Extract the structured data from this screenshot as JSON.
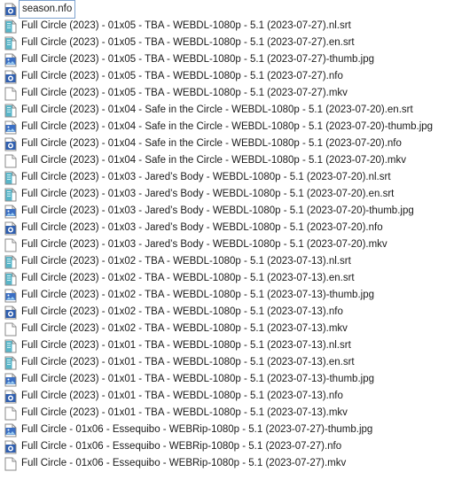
{
  "files": [
    {
      "name": "season.nfo",
      "icon": "nfo-file-icon",
      "selected": true
    },
    {
      "name": "Full Circle (2023) - 01x05 - TBA - WEBDL-1080p - 5.1 (2023-07-27).nl.srt",
      "icon": "srt-file-icon"
    },
    {
      "name": "Full Circle (2023) - 01x05 - TBA - WEBDL-1080p - 5.1 (2023-07-27).en.srt",
      "icon": "srt-file-icon"
    },
    {
      "name": "Full Circle (2023) - 01x05 - TBA - WEBDL-1080p - 5.1 (2023-07-27)-thumb.jpg",
      "icon": "jpg-file-icon"
    },
    {
      "name": "Full Circle (2023) - 01x05 - TBA - WEBDL-1080p - 5.1 (2023-07-27).nfo",
      "icon": "nfo-file-icon"
    },
    {
      "name": "Full Circle (2023) - 01x05 - TBA - WEBDL-1080p - 5.1 (2023-07-27).mkv",
      "icon": "mkv-file-icon"
    },
    {
      "name": "Full Circle (2023) - 01x04 - Safe in the Circle - WEBDL-1080p - 5.1 (2023-07-20).en.srt",
      "icon": "srt-file-icon"
    },
    {
      "name": "Full Circle (2023) - 01x04 - Safe in the Circle - WEBDL-1080p - 5.1 (2023-07-20)-thumb.jpg",
      "icon": "jpg-file-icon"
    },
    {
      "name": "Full Circle (2023) - 01x04 - Safe in the Circle - WEBDL-1080p - 5.1 (2023-07-20).nfo",
      "icon": "nfo-file-icon"
    },
    {
      "name": "Full Circle (2023) - 01x04 - Safe in the Circle - WEBDL-1080p - 5.1 (2023-07-20).mkv",
      "icon": "mkv-file-icon"
    },
    {
      "name": "Full Circle (2023) - 01x03 - Jared’s Body - WEBDL-1080p - 5.1 (2023-07-20).nl.srt",
      "icon": "srt-file-icon"
    },
    {
      "name": "Full Circle (2023) - 01x03 - Jared’s Body - WEBDL-1080p - 5.1 (2023-07-20).en.srt",
      "icon": "srt-file-icon"
    },
    {
      "name": "Full Circle (2023) - 01x03 - Jared’s Body - WEBDL-1080p - 5.1 (2023-07-20)-thumb.jpg",
      "icon": "jpg-file-icon"
    },
    {
      "name": "Full Circle (2023) - 01x03 - Jared’s Body - WEBDL-1080p - 5.1 (2023-07-20).nfo",
      "icon": "nfo-file-icon"
    },
    {
      "name": "Full Circle (2023) - 01x03 - Jared’s Body - WEBDL-1080p - 5.1 (2023-07-20).mkv",
      "icon": "mkv-file-icon"
    },
    {
      "name": "Full Circle (2023) - 01x02 - TBA - WEBDL-1080p - 5.1 (2023-07-13).nl.srt",
      "icon": "srt-file-icon"
    },
    {
      "name": "Full Circle (2023) - 01x02 - TBA - WEBDL-1080p - 5.1 (2023-07-13).en.srt",
      "icon": "srt-file-icon"
    },
    {
      "name": "Full Circle (2023) - 01x02 - TBA - WEBDL-1080p - 5.1 (2023-07-13)-thumb.jpg",
      "icon": "jpg-file-icon"
    },
    {
      "name": "Full Circle (2023) - 01x02 - TBA - WEBDL-1080p - 5.1 (2023-07-13).nfo",
      "icon": "nfo-file-icon"
    },
    {
      "name": "Full Circle (2023) - 01x02 - TBA - WEBDL-1080p - 5.1 (2023-07-13).mkv",
      "icon": "mkv-file-icon"
    },
    {
      "name": "Full Circle (2023) - 01x01 - TBA - WEBDL-1080p - 5.1 (2023-07-13).nl.srt",
      "icon": "srt-file-icon"
    },
    {
      "name": "Full Circle (2023) - 01x01 - TBA - WEBDL-1080p - 5.1 (2023-07-13).en.srt",
      "icon": "srt-file-icon"
    },
    {
      "name": "Full Circle (2023) - 01x01 - TBA - WEBDL-1080p - 5.1 (2023-07-13)-thumb.jpg",
      "icon": "jpg-file-icon"
    },
    {
      "name": "Full Circle (2023) - 01x01 - TBA - WEBDL-1080p - 5.1 (2023-07-13).nfo",
      "icon": "nfo-file-icon"
    },
    {
      "name": "Full Circle (2023) - 01x01 - TBA - WEBDL-1080p - 5.1 (2023-07-13).mkv",
      "icon": "mkv-file-icon"
    },
    {
      "name": "Full Circle - 01x06 - Essequibo - WEBRip-1080p - 5.1 (2023-07-27)-thumb.jpg",
      "icon": "jpg-file-icon"
    },
    {
      "name": "Full Circle - 01x06 - Essequibo - WEBRip-1080p - 5.1 (2023-07-27).nfo",
      "icon": "nfo-file-icon"
    },
    {
      "name": "Full Circle - 01x06 - Essequibo - WEBRip-1080p - 5.1 (2023-07-27).mkv",
      "icon": "mkv-file-icon"
    }
  ],
  "colors": {
    "selection_border": "#7da2ce",
    "nfo_blue": "#2f5fb0",
    "srt_teal": "#3a9fb5",
    "jpg_blue": "#3b6fc4"
  }
}
